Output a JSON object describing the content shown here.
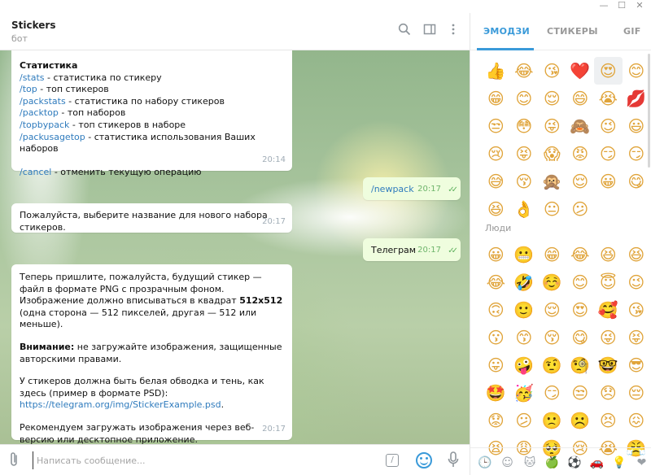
{
  "window": {
    "minimize": "—",
    "maximize": "☐",
    "close": "✕"
  },
  "header": {
    "title": "Stickers",
    "subtitle": "бот"
  },
  "messages": {
    "stats": {
      "heading": "Статистика",
      "lines": [
        {
          "cmd": "/stats",
          "desc": " - статистика по стикеру"
        },
        {
          "cmd": "/top",
          "desc": " - топ стикеров"
        },
        {
          "cmd": "/packstats",
          "desc": " - статистика по набору стикеров"
        },
        {
          "cmd": "/packtop",
          "desc": " - топ наборов"
        },
        {
          "cmd": "/topbypack",
          "desc": " - топ стикеров в наборе"
        },
        {
          "cmd": "/packusagetop",
          "desc": " - статистика использования Ваших наборов"
        }
      ],
      "cancel_cmd": "/cancel",
      "cancel_desc": " - отменить текущую операцию",
      "time": "20:14"
    },
    "newpack": {
      "text": "/newpack",
      "time": "20:17"
    },
    "choose_name": {
      "text": "Пожалуйста, выберите название для нового набора стикеров.",
      "time": "20:17"
    },
    "telegram": {
      "text": "Телеграм",
      "time": "20:17"
    },
    "send_sticker": {
      "p1a": "Теперь пришлите, пожалуйста, будущий стикер — файл в формате PNG с прозрачным фоном. Изображение должно вписываться в квадрат ",
      "p1b": "512x512",
      "p1c": " (одна сторона — 512 пикселей, другая — 512 или меньше).",
      "warn_bold": "Внимание:",
      "warn_text": " не загружайте изображения, защищенные авторскими правами.",
      "p3": "У стикеров должна быть белая обводка и тень, как здесь (пример в формате PSD):",
      "link": "https://telegram.org/img/StickerExample.psd",
      "link_suffix": ".",
      "p4": "Рекомендуем загружать изображения через веб-версию или десктопное приложение.",
      "time": "20:17"
    }
  },
  "composer": {
    "placeholder": "Написать сообщение...",
    "cmd_icon": "/"
  },
  "panel": {
    "tabs": [
      "ЭМОДЗИ",
      "СТИКЕРЫ",
      "GIF"
    ],
    "recent": [
      "👍",
      "😂",
      "😘",
      "❤️",
      "😍",
      "😊",
      "😁",
      "😊",
      "😌",
      "😄",
      "😭",
      "💋",
      "😒",
      "😳",
      "😜",
      "🙈",
      "😉",
      "😃",
      "😢",
      "😝",
      "😱",
      "😡",
      "😏",
      "😏",
      "😅",
      "😚",
      "🙊",
      "😌",
      "😀",
      "😋",
      "😆",
      "👌",
      "😐",
      "😕"
    ],
    "people_title": "Люди",
    "people": [
      "😀",
      "😬",
      "😁",
      "😂",
      "😆",
      "😆",
      "😂",
      "🤣",
      "☺️",
      "😊",
      "😇",
      "😉",
      "🙃",
      "🙂",
      "😌",
      "😍",
      "🥰",
      "😘",
      "😗",
      "😙",
      "😚",
      "😋",
      "😜",
      "😝",
      "😛",
      "🤪",
      "🤨",
      "🧐",
      "🤓",
      "😎",
      "🤩",
      "🥳",
      "😏",
      "😒",
      "😞",
      "😔",
      "😟",
      "😕",
      "🙁",
      "☹️",
      "😣",
      "😖",
      "😫",
      "😩",
      "🥺",
      "😢",
      "😭",
      "😤"
    ],
    "categories": [
      "🕒",
      "☺",
      "🐱",
      "🍏",
      "⚽",
      "🚗",
      "💡",
      "❤"
    ]
  }
}
